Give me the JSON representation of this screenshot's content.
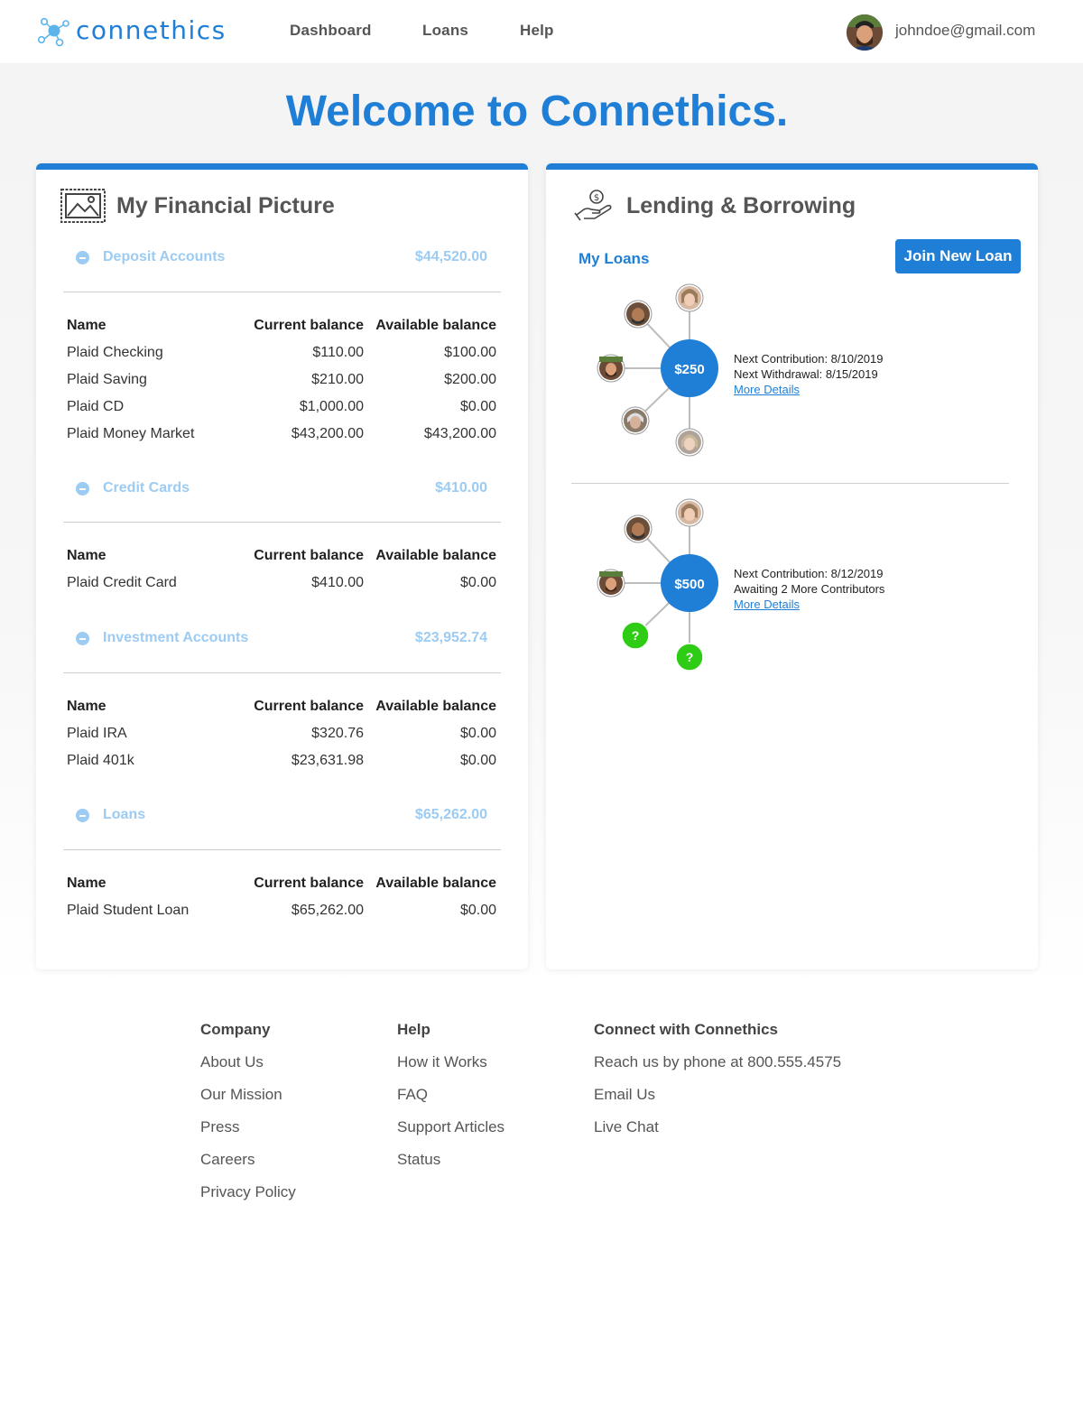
{
  "header": {
    "brand": "connethics",
    "nav": [
      "Dashboard",
      "Loans",
      "Help"
    ],
    "user_email": "johndoe@gmail.com"
  },
  "welcome": "Welcome to Connethics.",
  "financial": {
    "title": "My Financial Picture",
    "sections": [
      {
        "name": "Deposit Accounts",
        "total": "$44,520.00",
        "columns": [
          "Name",
          "Current balance",
          "Available balance"
        ],
        "rows": [
          [
            "Plaid Checking",
            "$110.00",
            "$100.00"
          ],
          [
            "Plaid Saving",
            "$210.00",
            "$200.00"
          ],
          [
            "Plaid CD",
            "$1,000.00",
            "$0.00"
          ],
          [
            "Plaid Money Market",
            "$43,200.00",
            "$43,200.00"
          ]
        ]
      },
      {
        "name": "Credit Cards",
        "total": "$410.00",
        "columns": [
          "Name",
          "Current balance",
          "Available balance"
        ],
        "rows": [
          [
            "Plaid Credit Card",
            "$410.00",
            "$0.00"
          ]
        ]
      },
      {
        "name": "Investment Accounts",
        "total": "$23,952.74",
        "columns": [
          "Name",
          "Current balance",
          "Available balance"
        ],
        "rows": [
          [
            "Plaid IRA",
            "$320.76",
            "$0.00"
          ],
          [
            "Plaid 401k",
            "$23,631.98",
            "$0.00"
          ]
        ]
      },
      {
        "name": "Loans",
        "total": "$65,262.00",
        "columns": [
          "Name",
          "Current balance",
          "Available balance"
        ],
        "rows": [
          [
            "Plaid Student Loan",
            "$65,262.00",
            "$0.00"
          ]
        ]
      }
    ]
  },
  "lending": {
    "title": "Lending & Borrowing",
    "my_loans": "My Loans",
    "join_button": "Join New Loan",
    "loans": [
      {
        "amount": "$250",
        "line1": "Next Contribution: 8/10/2019",
        "line2": "Next Withdrawal: 8/15/2019",
        "link": "More Details",
        "unknown_members": 0
      },
      {
        "amount": "$500",
        "line1": "Next Contribution: 8/12/2019",
        "line2": "Awaiting 2 More Contributors",
        "link": "More Details",
        "unknown_members": 2,
        "unknown_label": "?"
      }
    ]
  },
  "footer": {
    "company": {
      "heading": "Company",
      "links": [
        "About Us",
        "Our Mission",
        "Press",
        "Careers",
        "Privacy Policy"
      ]
    },
    "help": {
      "heading": "Help",
      "links": [
        "How it Works",
        "FAQ",
        "Support Articles",
        "Status"
      ]
    },
    "connect": {
      "heading": "Connect with Connethics",
      "links": [
        "Reach us by phone at 800.555.4575",
        "Email Us",
        "Live Chat"
      ]
    }
  },
  "colors": {
    "brand": "#1f7fd6",
    "section_header": "#9ccbf3",
    "unknown_member": "#2ecc14"
  }
}
